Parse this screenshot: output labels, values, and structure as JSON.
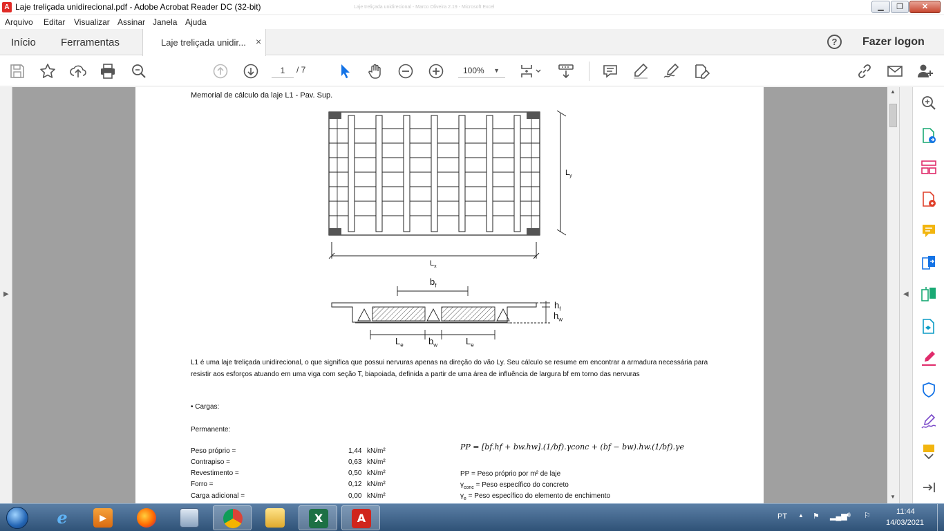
{
  "window": {
    "title": "Laje treliçada unidirecional.pdf - Adobe Acrobat Reader DC (32-bit)",
    "background_title": "Laje treliçada unidirecional - Marco Oliveira 2.19 - Microsoft Excel"
  },
  "menu": {
    "items": [
      "Arquivo",
      "Editar",
      "Visualizar",
      "Assinar",
      "Janela",
      "Ajuda"
    ]
  },
  "tabs": {
    "home": "Início",
    "tools": "Ferramentas",
    "document": "Laje treliçada unidir...",
    "close_symbol": "×",
    "help_symbol": "?",
    "login": "Fazer logon"
  },
  "toolbar": {
    "current_page": "1",
    "total_pages": "/ 7",
    "zoom": "100%",
    "icons": [
      "save-icon",
      "star-icon",
      "upload-icon",
      "print-icon",
      "search-zoom-icon",
      "page-up-icon",
      "page-down-icon",
      "select-cursor-icon",
      "hand-icon",
      "zoom-out-icon",
      "zoom-in-icon",
      "page-fit-icon",
      "scroll-mode-icon",
      "comment-icon",
      "highlight-icon",
      "sign-icon",
      "fill-sign-icon",
      "link-icon",
      "email-icon",
      "add-user-icon"
    ]
  },
  "document": {
    "heading": "Memorial de cálculo da laje L1 - Pav. Sup.",
    "dims": {
      "ly": "L",
      "ly_sub": "y",
      "lx": "L",
      "lx_sub": "x",
      "bf": "b",
      "bf_sub": "f",
      "hf": "h",
      "hf_sub": "f",
      "hw": "h",
      "hw_sub": "w",
      "le": "L",
      "le_sub": "e",
      "bw": "b",
      "bw_sub": "w"
    },
    "paragraph": "L1 é uma laje treliçada unidirecional, o que significa que possui nervuras apenas na direção do vão Ly. Seu cálculo se resume em encontrar a armadura necessária para resistir aos esforços atuando em uma viga com seção T, biapoiada, definida a partir de uma área de influência de largura bf em torno das nervuras",
    "bullet": "• Cargas:",
    "permanent": "Permanente:",
    "loads": [
      {
        "label": "Peso próprio =",
        "value": "1,44",
        "unit": "kN/m²"
      },
      {
        "label": "Contrapiso =",
        "value": "0,63",
        "unit": "kN/m²"
      },
      {
        "label": "Revestimento =",
        "value": "0,50",
        "unit": "kN/m²"
      },
      {
        "label": "Forro =",
        "value": "0,12",
        "unit": "kN/m²"
      },
      {
        "label": "Carga adicional =",
        "value": "0,00",
        "unit": "kN/m²"
      }
    ],
    "formula": "PP = [bf.hf + bw.hw].(1/bf).γconc + (bf − bw).hw.(1/bf).γe",
    "legend": [
      {
        "sym": "PP",
        "sub": "",
        "text": " = Peso próprio por m² de laje"
      },
      {
        "sym": "γ",
        "sub": "conc",
        "text": " = Peso específico do concreto"
      },
      {
        "sym": "γ",
        "sub": "e",
        "text": " = Peso específico do elemento de enchimento"
      }
    ]
  },
  "right_tools": [
    "zoom-tool-icon",
    "export-pdf-icon",
    "organize-pages-icon",
    "create-pdf-icon",
    "comment-tool-icon",
    "combine-files-icon",
    "compare-icon",
    "send-for-review-icon",
    "fill-sign-tool-icon",
    "protect-icon",
    "signature-icon",
    "more-tools-icon",
    "expand-icon"
  ],
  "taskbar": {
    "apps": [
      "internet-explorer-icon",
      "media-player-icon",
      "firefox-icon",
      "remote-desktop-icon",
      "chrome-icon",
      "file-explorer-icon",
      "excel-icon",
      "acrobat-icon"
    ],
    "language": "PT",
    "time": "11:44",
    "date": "14/03/2021"
  }
}
